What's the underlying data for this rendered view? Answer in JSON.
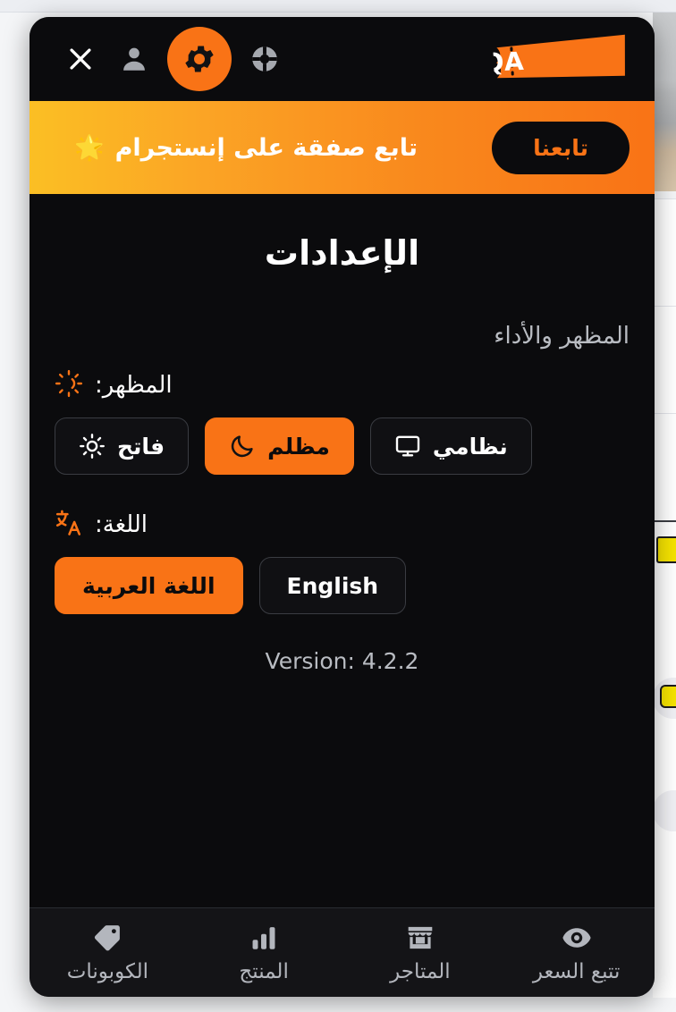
{
  "header": {
    "icons": [
      {
        "name": "close-icon",
        "label": "إغلاق",
        "active": false
      },
      {
        "name": "user-icon",
        "label": "الحساب",
        "active": false
      },
      {
        "name": "gear-icon",
        "label": "الإعدادات",
        "active": true
      },
      {
        "name": "lifebuoy-icon",
        "label": "الدعم",
        "active": false
      }
    ],
    "logo_text": "SAFQA"
  },
  "banner": {
    "star": "🌟",
    "text": "تابع صفقة على إنستجرام",
    "button_label": "تابعنا"
  },
  "main": {
    "title": "الإعدادات",
    "section_heading": "المظهر والأداء",
    "theme": {
      "label": "المظهر:",
      "icon": "sun-moon-icon",
      "options": [
        {
          "label": "فاتح",
          "icon": "sun-icon",
          "selected": false
        },
        {
          "label": "مظلم",
          "icon": "moon-icon",
          "selected": true
        },
        {
          "label": "نظامي",
          "icon": "monitor-icon",
          "selected": false
        }
      ]
    },
    "language": {
      "label": "اللغة:",
      "icon": "translate-icon",
      "options": [
        {
          "label": "اللغة العربية",
          "selected": true
        },
        {
          "label": "English",
          "selected": false
        }
      ]
    },
    "version": "Version: 4.2.2"
  },
  "bottom_nav": [
    {
      "label": "الكوبونات",
      "icon": "tag-icon"
    },
    {
      "label": "المنتج",
      "icon": "bar-chart-icon"
    },
    {
      "label": "المتاجر",
      "icon": "store-icon"
    },
    {
      "label": "تتبع السعر",
      "icon": "eye-icon"
    }
  ],
  "colors": {
    "accent": "#f97316",
    "banner_start": "#fbbf24",
    "banner_end": "#f97316",
    "surface": "#0b0b0d",
    "nav_surface": "#141417",
    "muted_text": "#b9bcc2"
  }
}
